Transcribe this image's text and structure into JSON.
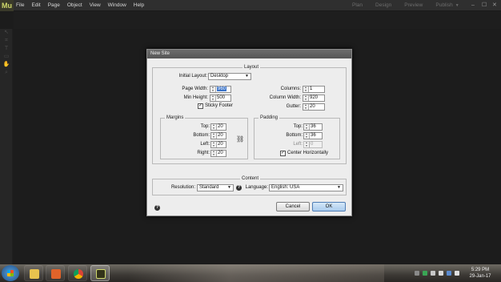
{
  "app": {
    "logo": "Mu"
  },
  "menu": [
    "File",
    "Edit",
    "Page",
    "Object",
    "View",
    "Window",
    "Help"
  ],
  "modes": {
    "plan": "Plan",
    "design": "Design",
    "preview": "Preview",
    "publish": "Publish"
  },
  "window_controls": {
    "minimize": "–",
    "maximize": "☐",
    "close": "✕"
  },
  "dialog": {
    "title": "New Site",
    "layout_group": "Layout",
    "initial_layout_label": "Initial Layout:",
    "initial_layout_value": "Desktop",
    "page_width_label": "Page Width:",
    "page_width": "960",
    "min_height_label": "Min Height:",
    "min_height": "500",
    "sticky_footer_label": "Sticky Footer",
    "sticky_footer_checked": true,
    "columns_label": "Columns:",
    "columns": "1",
    "column_width_label": "Column Width:",
    "column_width": "920",
    "gutter_label": "Gutter:",
    "gutter": "20",
    "margins_group": "Margins",
    "margins": {
      "top_label": "Top:",
      "top": "20",
      "bottom_label": "Bottom:",
      "bottom": "20",
      "left_label": "Left:",
      "left": "20",
      "right_label": "Right:",
      "right": "20"
    },
    "padding_group": "Padding",
    "padding": {
      "top_label": "Top:",
      "top": "36",
      "bottom_label": "Bottom:",
      "bottom": "36",
      "left_label": "Left:",
      "left": "0",
      "center_label": "Center Horizontally",
      "center_checked": true
    },
    "content_group": "Content",
    "resolution_label": "Resolution:",
    "resolution_value": "Standard",
    "language_label": "Language:",
    "language_value": "English: USA",
    "cancel_label": "Cancel",
    "ok_label": "OK"
  },
  "taskbar": {
    "time": "5:29 PM",
    "date": "29-Jan-17"
  }
}
